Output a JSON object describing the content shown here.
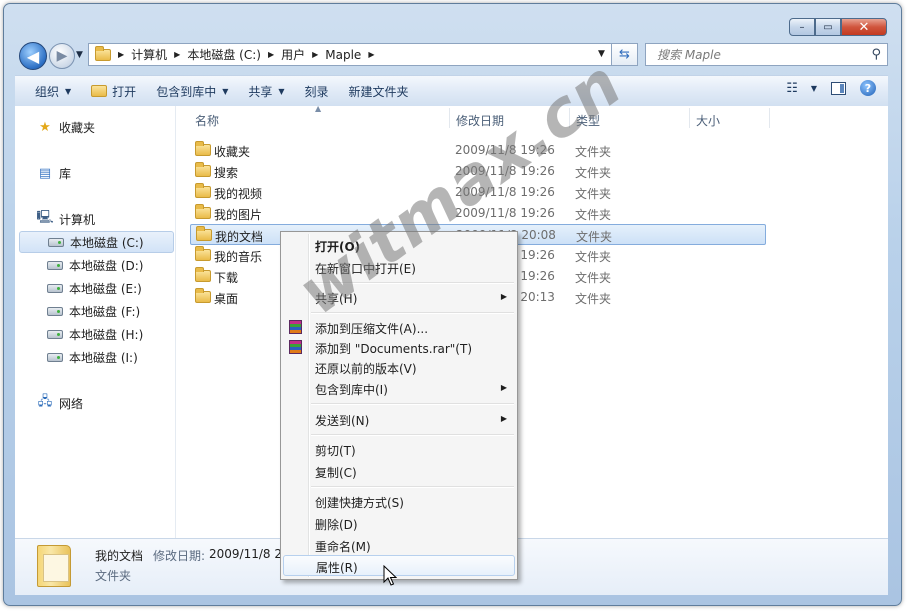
{
  "window": {
    "caption": {
      "minimize": "–",
      "maximize": "▭",
      "close": "✕"
    }
  },
  "nav": {
    "back_glyph": "◀",
    "forward_glyph": "▶",
    "breadcrumb": [
      "计算机",
      "本地磁盘 (C:)",
      "用户",
      "Maple"
    ],
    "search_placeholder": "搜索 Maple"
  },
  "toolbar": {
    "organize": "组织",
    "open": "打开",
    "include_in_library": "包含到库中",
    "share": "共享",
    "burn": "刻录",
    "new_folder": "新建文件夹",
    "help_glyph": "?"
  },
  "sidebar": {
    "favorites": "收藏夹",
    "libraries": "库",
    "computer": "计算机",
    "drives": [
      "本地磁盘 (C:)",
      "本地磁盘 (D:)",
      "本地磁盘 (E:)",
      "本地磁盘 (F:)",
      "本地磁盘 (H:)",
      "本地磁盘 (I:)"
    ],
    "network": "网络"
  },
  "columns": {
    "name": "名称",
    "modified": "修改日期",
    "type": "类型",
    "size": "大小"
  },
  "files": [
    {
      "name": "收藏夹",
      "date": "2009/11/8 19:26",
      "type": "文件夹"
    },
    {
      "name": "搜索",
      "date": "2009/11/8 19:26",
      "type": "文件夹"
    },
    {
      "name": "我的视频",
      "date": "2009/11/8 19:26",
      "type": "文件夹"
    },
    {
      "name": "我的图片",
      "date": "2009/11/8 19:26",
      "type": "文件夹"
    },
    {
      "name": "我的文档",
      "date": "2009/11/8 20:08",
      "type": "文件夹"
    },
    {
      "name": "我的音乐",
      "date": "2009/11/8 19:26",
      "type": "文件夹"
    },
    {
      "name": "下载",
      "date": "2009/11/8 19:26",
      "type": "文件夹"
    },
    {
      "name": "桌面",
      "date": "2009/11/8 20:13",
      "type": "文件夹"
    }
  ],
  "details": {
    "name": "我的文档",
    "modified_label": "修改日期:",
    "modified_value": "2009/11/8 20:08",
    "type": "文件夹"
  },
  "context_menu": {
    "open": "打开(O)",
    "open_new_window": "在新窗口中打开(E)",
    "share": "共享(H)",
    "add_to_archive": "添加到压缩文件(A)...",
    "add_to_rar": "添加到 \"Documents.rar\"(T)",
    "restore_versions": "还原以前的版本(V)",
    "include_in_library": "包含到库中(I)",
    "send_to": "发送到(N)",
    "cut": "剪切(T)",
    "copy": "复制(C)",
    "create_shortcut": "创建快捷方式(S)",
    "delete": "删除(D)",
    "rename": "重命名(M)",
    "properties": "属性(R)"
  },
  "watermark": "witmax.cn"
}
